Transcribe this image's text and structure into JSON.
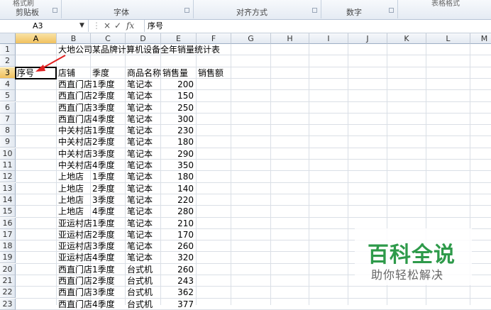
{
  "ribbon": {
    "groups": [
      "剪贴板",
      "字体",
      "对齐方式",
      "数字"
    ],
    "partial_top": [
      "格式刷",
      "表格格式"
    ]
  },
  "formula_bar": {
    "name_box": "A3",
    "name_box_arrow": "▼",
    "cancel_icon": "×",
    "enter_icon": "✓",
    "fx_label": "fx",
    "content": "序号"
  },
  "columns": [
    "A",
    "B",
    "C",
    "D",
    "E",
    "F",
    "G",
    "H",
    "I",
    "J",
    "K",
    "L",
    "M"
  ],
  "rows": [
    "1",
    "2",
    "3",
    "4",
    "5",
    "6",
    "7",
    "8",
    "9",
    "10",
    "11",
    "12",
    "13",
    "14",
    "15",
    "16",
    "17",
    "18",
    "19",
    "20",
    "21",
    "22",
    "23"
  ],
  "title": "大地公司某品牌计算机设备全年销量统计表",
  "headers": [
    "序号",
    "店铺",
    "季度",
    "商品名称",
    "销售量",
    "销售额"
  ],
  "data_rows": [
    [
      "西直门店",
      "1季度",
      "笔记本",
      "200"
    ],
    [
      "西直门店",
      "2季度",
      "笔记本",
      "150"
    ],
    [
      "西直门店",
      "3季度",
      "笔记本",
      "250"
    ],
    [
      "西直门店",
      "4季度",
      "笔记本",
      "300"
    ],
    [
      "中关村店",
      "1季度",
      "笔记本",
      "230"
    ],
    [
      "中关村店",
      "2季度",
      "笔记本",
      "180"
    ],
    [
      "中关村店",
      "3季度",
      "笔记本",
      "290"
    ],
    [
      "中关村店",
      "4季度",
      "笔记本",
      "350"
    ],
    [
      "上地店",
      "1季度",
      "笔记本",
      "180"
    ],
    [
      "上地店",
      "2季度",
      "笔记本",
      "140"
    ],
    [
      "上地店",
      "3季度",
      "笔记本",
      "220"
    ],
    [
      "上地店",
      "4季度",
      "笔记本",
      "280"
    ],
    [
      "亚运村店",
      "1季度",
      "笔记本",
      "210"
    ],
    [
      "亚运村店",
      "2季度",
      "笔记本",
      "170"
    ],
    [
      "亚运村店",
      "3季度",
      "笔记本",
      "260"
    ],
    [
      "亚运村店",
      "4季度",
      "笔记本",
      "320"
    ],
    [
      "西直门店",
      "1季度",
      "台式机",
      "260"
    ],
    [
      "西直门店",
      "2季度",
      "台式机",
      "243"
    ],
    [
      "西直门店",
      "3季度",
      "台式机",
      "362"
    ],
    [
      "西直门店",
      "4季度",
      "台式机",
      "377"
    ]
  ],
  "watermark": {
    "title": "百科全说",
    "subtitle": "助你轻松解决"
  },
  "colors": {
    "selected_header": "#f1c15f",
    "annotation_arrow": "#e02020",
    "watermark_green": "#2e9a4a"
  }
}
